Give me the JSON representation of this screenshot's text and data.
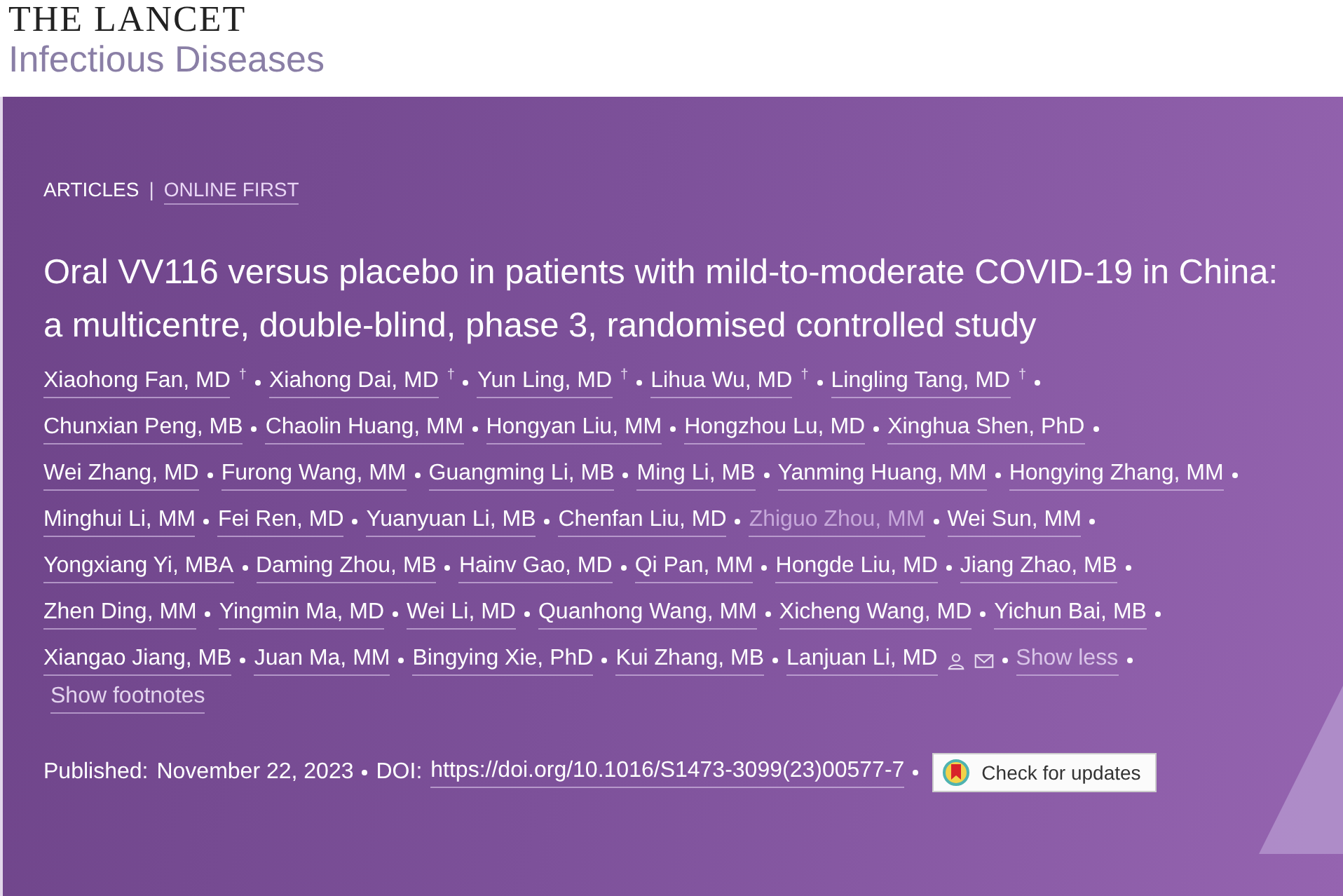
{
  "journal": {
    "name": "THE LANCET",
    "subtitle": "Infectious Diseases"
  },
  "article_type": "ARTICLES",
  "separator": "|",
  "status_link": "ONLINE FIRST",
  "title": "Oral VV116 versus placebo in patients with mild-to-moderate COVID-19 in China: a multicentre, double-blind, phase 3, randomised controlled study",
  "author_lines": [
    [
      {
        "name": "Xiaohong Fan, MD",
        "mark": "†",
        "dimmed": false
      },
      {
        "name": "Xiahong Dai, MD",
        "mark": "†",
        "dimmed": false
      },
      {
        "name": "Yun Ling, MD",
        "mark": "†",
        "dimmed": false
      },
      {
        "name": "Lihua Wu, MD",
        "mark": "†",
        "dimmed": false
      },
      {
        "name": "Lingling Tang, MD",
        "mark": "†",
        "dimmed": false
      }
    ],
    [
      {
        "name": "Chunxian Peng, MB",
        "dimmed": false
      },
      {
        "name": "Chaolin Huang, MM",
        "dimmed": false
      },
      {
        "name": "Hongyan Liu, MM",
        "dimmed": false
      },
      {
        "name": "Hongzhou Lu, MD",
        "dimmed": false
      },
      {
        "name": "Xinghua Shen, PhD",
        "dimmed": false
      }
    ],
    [
      {
        "name": "Wei Zhang, MD",
        "dimmed": false
      },
      {
        "name": "Furong Wang, MM",
        "dimmed": false
      },
      {
        "name": "Guangming Li, MB",
        "dimmed": false
      },
      {
        "name": "Ming Li, MB",
        "dimmed": false
      },
      {
        "name": "Yanming Huang, MM",
        "dimmed": false
      },
      {
        "name": "Hongying Zhang, MM",
        "dimmed": false
      }
    ],
    [
      {
        "name": "Minghui Li, MM",
        "dimmed": false
      },
      {
        "name": "Fei Ren, MD",
        "dimmed": false
      },
      {
        "name": "Yuanyuan Li, MB",
        "dimmed": false
      },
      {
        "name": "Chenfan Liu, MD",
        "dimmed": false
      },
      {
        "name": "Zhiguo Zhou, MM",
        "dimmed": true
      },
      {
        "name": "Wei Sun, MM",
        "dimmed": false
      }
    ],
    [
      {
        "name": "Yongxiang Yi, MBA",
        "dimmed": false
      },
      {
        "name": "Daming Zhou, MB",
        "dimmed": false
      },
      {
        "name": "Hainv Gao, MD",
        "dimmed": false
      },
      {
        "name": "Qi Pan, MM",
        "dimmed": false
      },
      {
        "name": "Hongde Liu, MD",
        "dimmed": false
      },
      {
        "name": "Jiang Zhao, MB",
        "dimmed": false
      }
    ],
    [
      {
        "name": "Zhen Ding, MM",
        "dimmed": false
      },
      {
        "name": "Yingmin Ma, MD",
        "dimmed": false
      },
      {
        "name": "Wei Li, MD",
        "dimmed": false
      },
      {
        "name": "Quanhong Wang, MM",
        "dimmed": false
      },
      {
        "name": "Xicheng Wang, MD",
        "dimmed": false
      },
      {
        "name": "Yichun Bai, MB",
        "dimmed": false
      }
    ],
    [
      {
        "name": "Xiangao Jiang, MB",
        "dimmed": false
      },
      {
        "name": "Juan Ma, MM",
        "dimmed": false
      },
      {
        "name": "Bingying Xie, PhD",
        "dimmed": false
      },
      {
        "name": "Kui Zhang, MB",
        "dimmed": false
      },
      {
        "name": "Lanjuan Li, MD",
        "dimmed": false,
        "corresponding": true
      }
    ]
  ],
  "show_less": "Show less",
  "show_footnotes": "Show footnotes",
  "published_label": "Published:",
  "published_date": "November 22, 2023",
  "doi_label": "DOI:",
  "doi": "https://doi.org/10.1016/S1473-3099(23)00577-7",
  "check_updates": "Check for updates"
}
